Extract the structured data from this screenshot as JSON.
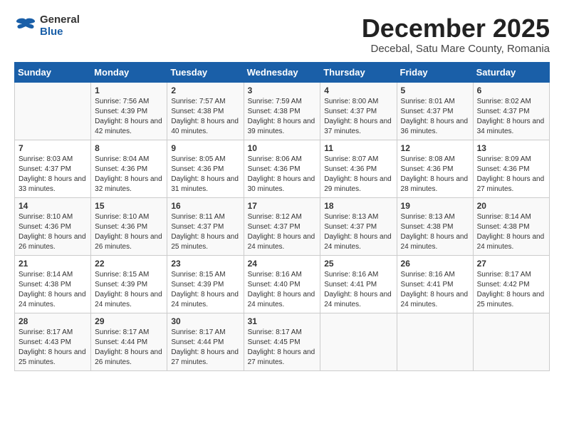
{
  "logo": {
    "general": "General",
    "blue": "Blue"
  },
  "title": "December 2025",
  "subtitle": "Decebal, Satu Mare County, Romania",
  "weekdays": [
    "Sunday",
    "Monday",
    "Tuesday",
    "Wednesday",
    "Thursday",
    "Friday",
    "Saturday"
  ],
  "weeks": [
    [
      {
        "num": "",
        "sunrise": "",
        "sunset": "",
        "daylight": ""
      },
      {
        "num": "1",
        "sunrise": "Sunrise: 7:56 AM",
        "sunset": "Sunset: 4:39 PM",
        "daylight": "Daylight: 8 hours and 42 minutes."
      },
      {
        "num": "2",
        "sunrise": "Sunrise: 7:57 AM",
        "sunset": "Sunset: 4:38 PM",
        "daylight": "Daylight: 8 hours and 40 minutes."
      },
      {
        "num": "3",
        "sunrise": "Sunrise: 7:59 AM",
        "sunset": "Sunset: 4:38 PM",
        "daylight": "Daylight: 8 hours and 39 minutes."
      },
      {
        "num": "4",
        "sunrise": "Sunrise: 8:00 AM",
        "sunset": "Sunset: 4:37 PM",
        "daylight": "Daylight: 8 hours and 37 minutes."
      },
      {
        "num": "5",
        "sunrise": "Sunrise: 8:01 AM",
        "sunset": "Sunset: 4:37 PM",
        "daylight": "Daylight: 8 hours and 36 minutes."
      },
      {
        "num": "6",
        "sunrise": "Sunrise: 8:02 AM",
        "sunset": "Sunset: 4:37 PM",
        "daylight": "Daylight: 8 hours and 34 minutes."
      }
    ],
    [
      {
        "num": "7",
        "sunrise": "Sunrise: 8:03 AM",
        "sunset": "Sunset: 4:37 PM",
        "daylight": "Daylight: 8 hours and 33 minutes."
      },
      {
        "num": "8",
        "sunrise": "Sunrise: 8:04 AM",
        "sunset": "Sunset: 4:36 PM",
        "daylight": "Daylight: 8 hours and 32 minutes."
      },
      {
        "num": "9",
        "sunrise": "Sunrise: 8:05 AM",
        "sunset": "Sunset: 4:36 PM",
        "daylight": "Daylight: 8 hours and 31 minutes."
      },
      {
        "num": "10",
        "sunrise": "Sunrise: 8:06 AM",
        "sunset": "Sunset: 4:36 PM",
        "daylight": "Daylight: 8 hours and 30 minutes."
      },
      {
        "num": "11",
        "sunrise": "Sunrise: 8:07 AM",
        "sunset": "Sunset: 4:36 PM",
        "daylight": "Daylight: 8 hours and 29 minutes."
      },
      {
        "num": "12",
        "sunrise": "Sunrise: 8:08 AM",
        "sunset": "Sunset: 4:36 PM",
        "daylight": "Daylight: 8 hours and 28 minutes."
      },
      {
        "num": "13",
        "sunrise": "Sunrise: 8:09 AM",
        "sunset": "Sunset: 4:36 PM",
        "daylight": "Daylight: 8 hours and 27 minutes."
      }
    ],
    [
      {
        "num": "14",
        "sunrise": "Sunrise: 8:10 AM",
        "sunset": "Sunset: 4:36 PM",
        "daylight": "Daylight: 8 hours and 26 minutes."
      },
      {
        "num": "15",
        "sunrise": "Sunrise: 8:10 AM",
        "sunset": "Sunset: 4:36 PM",
        "daylight": "Daylight: 8 hours and 26 minutes."
      },
      {
        "num": "16",
        "sunrise": "Sunrise: 8:11 AM",
        "sunset": "Sunset: 4:37 PM",
        "daylight": "Daylight: 8 hours and 25 minutes."
      },
      {
        "num": "17",
        "sunrise": "Sunrise: 8:12 AM",
        "sunset": "Sunset: 4:37 PM",
        "daylight": "Daylight: 8 hours and 24 minutes."
      },
      {
        "num": "18",
        "sunrise": "Sunrise: 8:13 AM",
        "sunset": "Sunset: 4:37 PM",
        "daylight": "Daylight: 8 hours and 24 minutes."
      },
      {
        "num": "19",
        "sunrise": "Sunrise: 8:13 AM",
        "sunset": "Sunset: 4:38 PM",
        "daylight": "Daylight: 8 hours and 24 minutes."
      },
      {
        "num": "20",
        "sunrise": "Sunrise: 8:14 AM",
        "sunset": "Sunset: 4:38 PM",
        "daylight": "Daylight: 8 hours and 24 minutes."
      }
    ],
    [
      {
        "num": "21",
        "sunrise": "Sunrise: 8:14 AM",
        "sunset": "Sunset: 4:38 PM",
        "daylight": "Daylight: 8 hours and 24 minutes."
      },
      {
        "num": "22",
        "sunrise": "Sunrise: 8:15 AM",
        "sunset": "Sunset: 4:39 PM",
        "daylight": "Daylight: 8 hours and 24 minutes."
      },
      {
        "num": "23",
        "sunrise": "Sunrise: 8:15 AM",
        "sunset": "Sunset: 4:39 PM",
        "daylight": "Daylight: 8 hours and 24 minutes."
      },
      {
        "num": "24",
        "sunrise": "Sunrise: 8:16 AM",
        "sunset": "Sunset: 4:40 PM",
        "daylight": "Daylight: 8 hours and 24 minutes."
      },
      {
        "num": "25",
        "sunrise": "Sunrise: 8:16 AM",
        "sunset": "Sunset: 4:41 PM",
        "daylight": "Daylight: 8 hours and 24 minutes."
      },
      {
        "num": "26",
        "sunrise": "Sunrise: 8:16 AM",
        "sunset": "Sunset: 4:41 PM",
        "daylight": "Daylight: 8 hours and 24 minutes."
      },
      {
        "num": "27",
        "sunrise": "Sunrise: 8:17 AM",
        "sunset": "Sunset: 4:42 PM",
        "daylight": "Daylight: 8 hours and 25 minutes."
      }
    ],
    [
      {
        "num": "28",
        "sunrise": "Sunrise: 8:17 AM",
        "sunset": "Sunset: 4:43 PM",
        "daylight": "Daylight: 8 hours and 25 minutes."
      },
      {
        "num": "29",
        "sunrise": "Sunrise: 8:17 AM",
        "sunset": "Sunset: 4:44 PM",
        "daylight": "Daylight: 8 hours and 26 minutes."
      },
      {
        "num": "30",
        "sunrise": "Sunrise: 8:17 AM",
        "sunset": "Sunset: 4:44 PM",
        "daylight": "Daylight: 8 hours and 27 minutes."
      },
      {
        "num": "31",
        "sunrise": "Sunrise: 8:17 AM",
        "sunset": "Sunset: 4:45 PM",
        "daylight": "Daylight: 8 hours and 27 minutes."
      },
      {
        "num": "",
        "sunrise": "",
        "sunset": "",
        "daylight": ""
      },
      {
        "num": "",
        "sunrise": "",
        "sunset": "",
        "daylight": ""
      },
      {
        "num": "",
        "sunrise": "",
        "sunset": "",
        "daylight": ""
      }
    ]
  ]
}
